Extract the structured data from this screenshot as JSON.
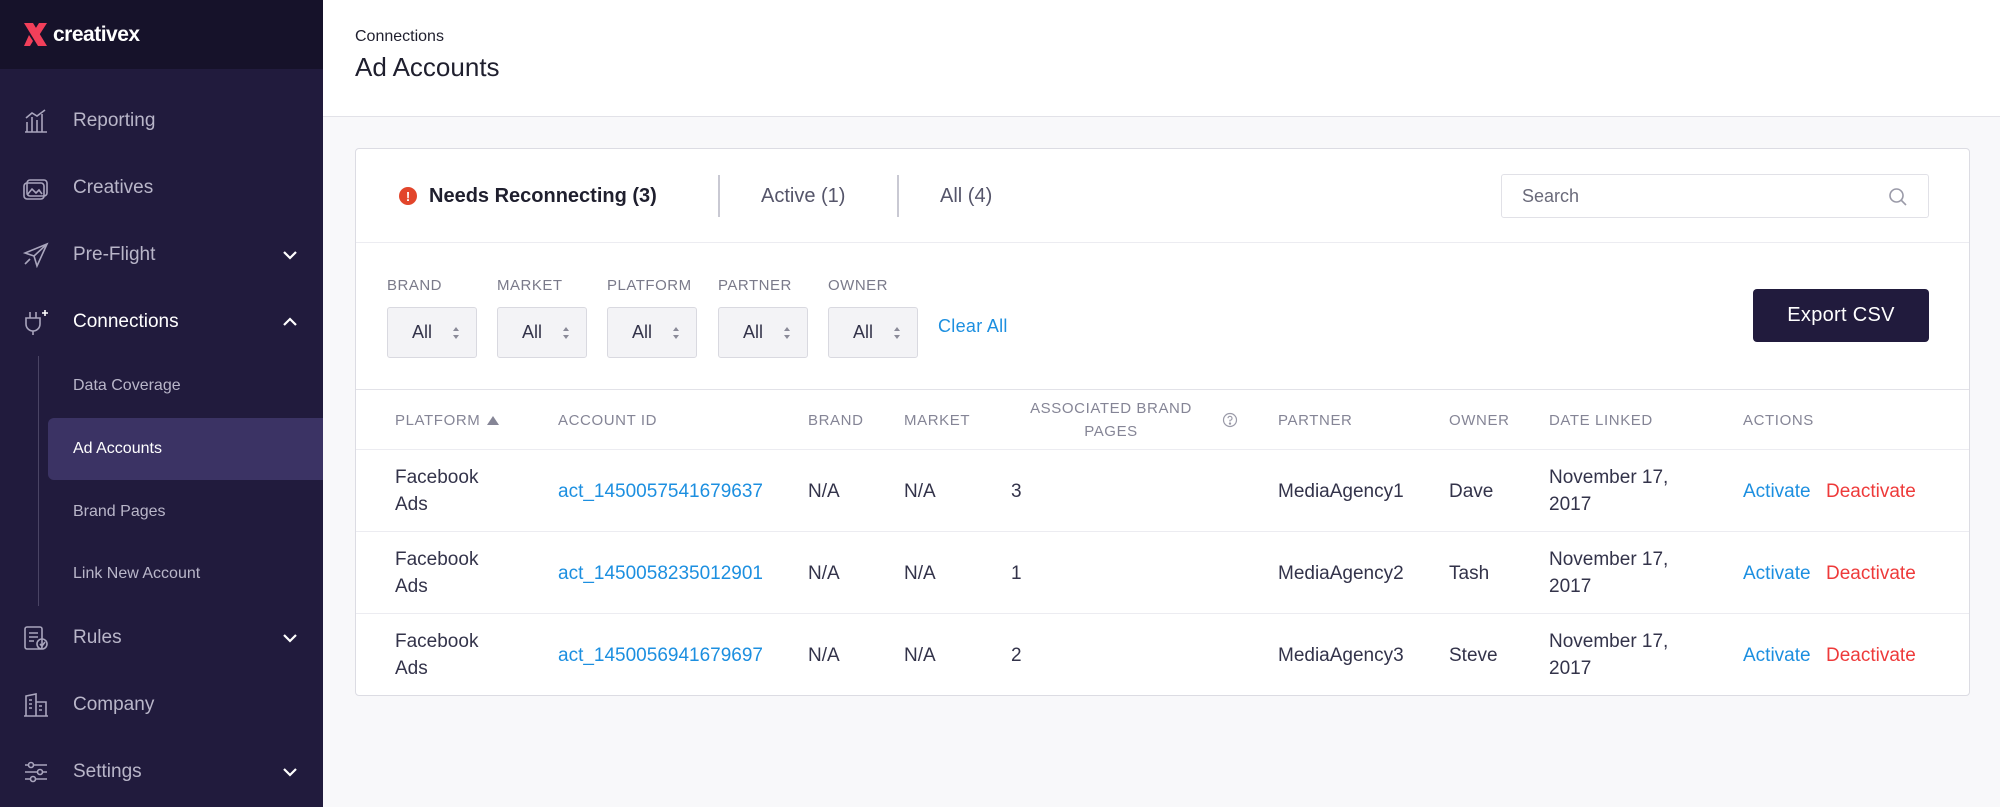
{
  "brand": {
    "name": "creativex",
    "accent": "#f23f5a"
  },
  "sidebar": {
    "items": [
      {
        "label": "Reporting",
        "icon": "chart-icon",
        "has_chevron": false
      },
      {
        "label": "Creatives",
        "icon": "creatives-icon",
        "has_chevron": false
      },
      {
        "label": "Pre-Flight",
        "icon": "paper-plane-icon",
        "has_chevron": true
      },
      {
        "label": "Connections",
        "icon": "plug-icon",
        "has_chevron": true,
        "open": true
      },
      {
        "label": "Rules",
        "icon": "rules-icon",
        "has_chevron": true
      },
      {
        "label": "Company",
        "icon": "building-icon",
        "has_chevron": false
      },
      {
        "label": "Settings",
        "icon": "sliders-icon",
        "has_chevron": true
      }
    ],
    "sub_items": [
      {
        "label": "Data Coverage"
      },
      {
        "label": "Ad Accounts",
        "active": true
      },
      {
        "label": "Brand Pages"
      },
      {
        "label": "Link New Account"
      }
    ]
  },
  "header": {
    "breadcrumb": "Connections",
    "title": "Ad Accounts"
  },
  "tabs": [
    {
      "label": "Needs Reconnecting (3)",
      "active": true,
      "warning": true
    },
    {
      "label": "Active (1)"
    },
    {
      "label": "All (4)"
    }
  ],
  "search": {
    "placeholder": "Search",
    "value": ""
  },
  "filters": [
    {
      "label": "BRAND",
      "value": "All"
    },
    {
      "label": "MARKET",
      "value": "All"
    },
    {
      "label": "PLATFORM",
      "value": "All"
    },
    {
      "label": "PARTNER",
      "value": "All"
    },
    {
      "label": "OWNER",
      "value": "All"
    }
  ],
  "clear_all": "Clear All",
  "export_label": "Export CSV",
  "table": {
    "columns": [
      "PLATFORM",
      "ACCOUNT ID",
      "BRAND",
      "MARKET",
      "ASSOCIATED BRAND PAGES",
      "PARTNER",
      "OWNER",
      "DATE LINKED",
      "ACTIONS"
    ],
    "sorted_column": "PLATFORM",
    "rows": [
      {
        "platform": "Facebook Ads",
        "account_id": "act_1450057541679637",
        "brand": "N/A",
        "market": "N/A",
        "pages": "3",
        "partner": "MediaAgency1",
        "owner": "Dave",
        "date": "November 17, 2017",
        "activate": "Activate",
        "deactivate": "Deactivate"
      },
      {
        "platform": "Facebook Ads",
        "account_id": "act_1450058235012901",
        "brand": "N/A",
        "market": "N/A",
        "pages": "1",
        "partner": "MediaAgency2",
        "owner": "Tash",
        "date": "November 17, 2017",
        "activate": "Activate",
        "deactivate": "Deactivate"
      },
      {
        "platform": "Facebook Ads",
        "account_id": "act_1450056941679697",
        "brand": "N/A",
        "market": "N/A",
        "pages": "2",
        "partner": "MediaAgency3",
        "owner": "Steve",
        "date": "November 17, 2017",
        "activate": "Activate",
        "deactivate": "Deactivate"
      }
    ]
  }
}
